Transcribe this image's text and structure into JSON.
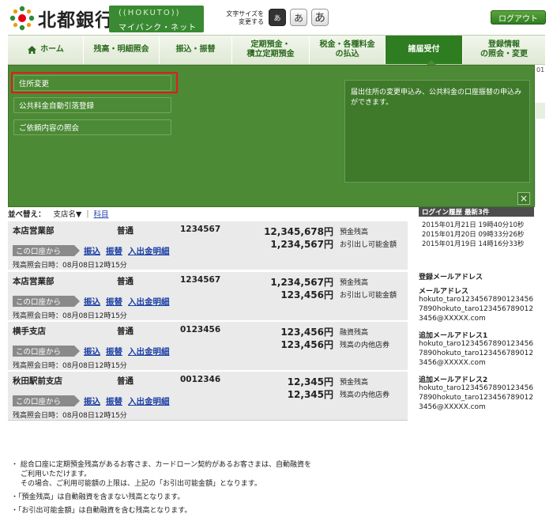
{
  "header": {
    "bank_name": "北都銀行",
    "band_en": "((HOKUTO))",
    "band_jp": "マイバンク・ネット",
    "font_size_label_1": "文字サイズを",
    "font_size_label_2": "変更する",
    "font_sizes": [
      "あ",
      "あ",
      "あ"
    ],
    "logout_label": "ログアウト"
  },
  "nav": {
    "items": [
      {
        "label": "ホーム"
      },
      {
        "label": "残高・明細照会"
      },
      {
        "label": "振込・振替"
      },
      {
        "label1": "定期預金・",
        "label2": "積立定期預金"
      },
      {
        "label1": "税金・各種料金",
        "label2": "の払込"
      },
      {
        "label": "諸届受付"
      },
      {
        "label1": "登録情報",
        "label2": "の照会・変更"
      }
    ]
  },
  "dropdown": {
    "items": [
      {
        "label": "住所変更"
      },
      {
        "label": "公共料金自動引落登録"
      },
      {
        "label": "ご依頼内容の照会"
      }
    ],
    "description": "届出住所の変更申込み、公共料金の口座振替の申込みができます。",
    "close": "×"
  },
  "date_fragment": "01",
  "sort": {
    "label": "並べ替え：",
    "option1": "支店名▼",
    "separator": "|",
    "option2": "科目"
  },
  "accounts": [
    {
      "branch": "本店営業部",
      "type": "普通",
      "number": "1234567",
      "amount1": "12,345,678円",
      "label1": "預金残高",
      "amount2": "1,234,567円",
      "label2": "お引出し可能金額",
      "from": "この口座から",
      "links": [
        "振込",
        "振替",
        "入出金明細"
      ],
      "timestamp": "残高照会日時：08月08日12時15分"
    },
    {
      "branch": "本店営業部",
      "type": "普通",
      "number": "1234567",
      "amount1": "1,234,567円",
      "label1": "預金残高",
      "amount2": "123,456円",
      "label2": "お引出し可能金額",
      "from": "この口座から",
      "links": [
        "振込",
        "振替",
        "入出金明細"
      ],
      "timestamp": "残高照会日時：08月08日12時15分"
    },
    {
      "branch": "横手支店",
      "type": "普通",
      "number": "0123456",
      "amount1": "123,456円",
      "label1": "融資残高",
      "amount2": "123,456円",
      "label2": "残高の内他店券",
      "from": "この口座から",
      "links": [
        "振込",
        "振替",
        "入出金明細"
      ],
      "timestamp": "残高照会日時：08月08日12時15分"
    },
    {
      "branch": "秋田駅前支店",
      "type": "普通",
      "number": "0012346",
      "amount1": "12,345円",
      "label1": "預金残高",
      "amount2": "12,345円",
      "label2": "残高の内他店券",
      "from": "この口座から",
      "links": [
        "振込",
        "振替",
        "入出金明細"
      ],
      "timestamp": "残高照会日時：08月08日12時15分"
    }
  ],
  "login_history": {
    "title": "ログイン履歴  最新3件",
    "entries": [
      "2015年01月21日 19時40分10秒",
      "2015年01月20日 09時33分26秒",
      "2015年01月19日 14時16分33秒"
    ]
  },
  "mail": {
    "title": "登録メールアドレス",
    "sections": [
      {
        "label": "メールアドレス",
        "lines": [
          "hokuto_taro1234567890123456",
          "7890hokuto_taro123456789012",
          "3456@XXXXX.com"
        ]
      },
      {
        "label": "追加メールアドレス1",
        "lines": [
          "hokuto_taro1234567890123456",
          "7890hokuto_taro123456789012",
          "3456@XXXXX.com"
        ]
      },
      {
        "label": "追加メールアドレス2",
        "lines": [
          "hokuto_taro1234567890123456",
          "7890hokuto_taro123456789012",
          "3456@XXXXX.com"
        ]
      }
    ]
  },
  "notes": [
    "・ 総合口座に定期預金残高があるお客さま、カードローン契約があるお客さまは、自動融資を",
    "ご利用いただけます。",
    "その場合、ご利用可能額の上限は、上記の「お引出可能金額」となります。",
    "・「預金残高」は自動融資を含まない残高となります。",
    "・「お引出可能金額」は自動融資を含む残高となります。"
  ]
}
